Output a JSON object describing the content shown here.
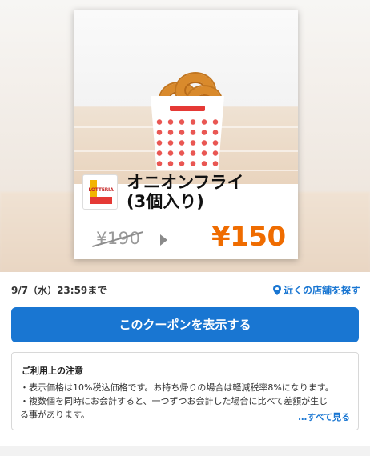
{
  "coupon": {
    "brand_logo_text": "LOTTERIA",
    "product_name_line1": "オニオンフライ",
    "product_name_line2": "(3個入り)",
    "old_price": "¥190",
    "new_price": "¥150",
    "bag_brand": "LOTTERIA"
  },
  "details": {
    "expiry": "9/7（水）23:59まで",
    "nearby_stores": "近くの店舗を探す",
    "show_coupon_button": "このクーポンを表示する"
  },
  "notes": {
    "title": "ご利用上の注意",
    "line1": "・表示価格は10%税込価格です。お持ち帰りの場合は軽減税率8%になります。",
    "line2": "・複数個を同時にお会計すると、一つずつお会計した場合に比べて差額が生じ",
    "line3": "る事があります。",
    "more_link": "…すべて見る"
  },
  "colors": {
    "accent_blue": "#1976d2",
    "price_orange": "#ef6c00",
    "brand_red": "#e53935",
    "brand_yellow": "#f2b400"
  },
  "icons": [
    "location-pin-icon",
    "arrow-right-icon"
  ]
}
